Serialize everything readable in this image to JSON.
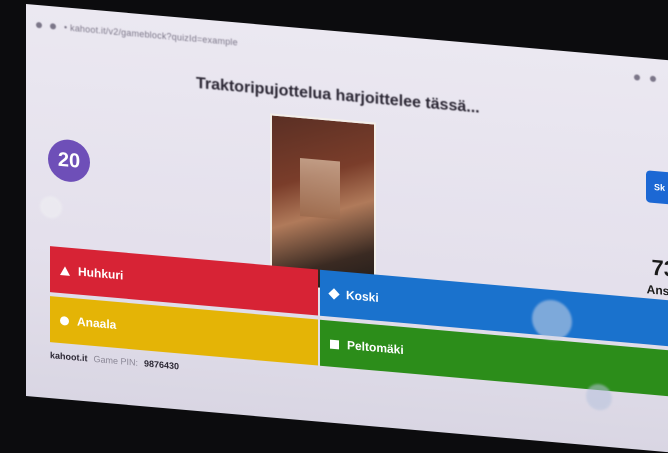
{
  "browser": {
    "url": "• kahoot.it/v2/gameblock?quizId=example"
  },
  "question": {
    "title": "Traktoripujottelua harjoittelee tässä..."
  },
  "timer": {
    "seconds": "20"
  },
  "skip_button": {
    "label": "Sk"
  },
  "answers_count": {
    "number": "73",
    "label": "Ansa"
  },
  "answers": [
    {
      "label": "Huhkuri",
      "shape": "triangle-icon",
      "color": "#d72335"
    },
    {
      "label": "Koski",
      "shape": "diamond-icon",
      "color": "#1a72cd"
    },
    {
      "label": "Anaala",
      "shape": "circle-icon",
      "color": "#e4b406"
    },
    {
      "label": "Peltomäki",
      "shape": "square-icon",
      "color": "#2c8d1a"
    }
  ],
  "footer": {
    "site": "kahoot.it",
    "pin_label": "Game PIN:",
    "pin": "9876430"
  },
  "colors": {
    "accent": "#6e4fb8",
    "skip": "#1c68d4"
  }
}
